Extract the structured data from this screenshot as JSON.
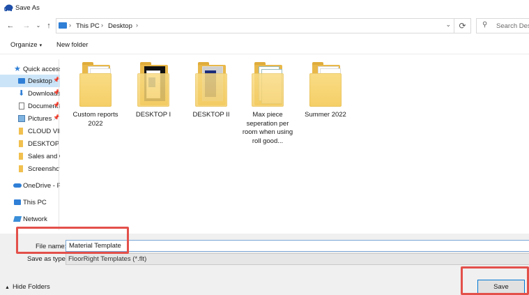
{
  "window": {
    "title": "Save As",
    "app_icon": "floorright-elephant-icon"
  },
  "address": {
    "crumbs": [
      "This PC",
      "Desktop"
    ],
    "search_placeholder": "Search Desktop"
  },
  "toolbar": {
    "organize_label": "Organize",
    "new_folder_label": "New folder"
  },
  "nav": {
    "items": [
      {
        "label": "Quick access",
        "icon": "star-icon",
        "pinned": false,
        "selected": false
      },
      {
        "label": "Desktop",
        "icon": "desktop-icon",
        "pinned": true,
        "selected": true
      },
      {
        "label": "Downloads",
        "icon": "download-arrow-icon",
        "pinned": true,
        "selected": false
      },
      {
        "label": "Documents",
        "icon": "documents-icon",
        "pinned": true,
        "selected": false
      },
      {
        "label": "Pictures",
        "icon": "pictures-icon",
        "pinned": true,
        "selected": false
      },
      {
        "label": "CLOUD VIDEOS",
        "icon": "folder-icon",
        "pinned": false,
        "selected": false
      },
      {
        "label": "DESKTOP I",
        "icon": "folder-icon",
        "pinned": false,
        "selected": false
      },
      {
        "label": "Sales and C",
        "icon": "folder-icon",
        "pinned": false,
        "selected": false
      },
      {
        "label": "Screenshots",
        "icon": "folder-icon",
        "pinned": false,
        "selected": false
      },
      {
        "label": "OneDrive - Personal",
        "icon": "onedrive-cloud-icon",
        "pinned": false,
        "selected": false
      },
      {
        "label": "This PC",
        "icon": "this-pc-icon",
        "pinned": false,
        "selected": false
      },
      {
        "label": "Network",
        "icon": "network-icon",
        "pinned": false,
        "selected": false
      }
    ]
  },
  "files": [
    {
      "name": "Custom reports 2022"
    },
    {
      "name": "DESKTOP I"
    },
    {
      "name": "DESKTOP II"
    },
    {
      "name": "Max piece seperation per room when using roll good..."
    },
    {
      "name": "Summer 2022"
    }
  ],
  "save_form": {
    "file_name_label": "File name:",
    "file_name_value": "Material Template",
    "save_as_type_label": "Save as type:",
    "save_as_type_value": "FloorRight Templates (*.flt)",
    "save_label": "Save",
    "hide_folders_label": "Hide Folders"
  },
  "colors": {
    "highlight": "#e3504a",
    "selection": "#cce4f7",
    "accent": "#0078d4",
    "folder": "#f5cf67"
  }
}
